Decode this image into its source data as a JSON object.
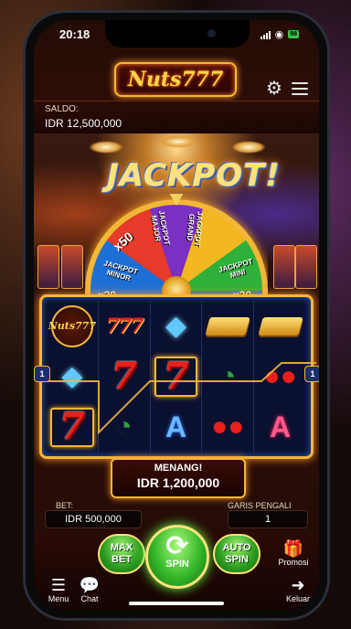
{
  "status": {
    "time": "20:18",
    "battery": "98"
  },
  "header": {
    "logo": "Nuts777"
  },
  "balance": {
    "label": "SALDO:",
    "value": "IDR 12,500,000"
  },
  "banner": {
    "title": "JACKPOT!",
    "wheel_segments": [
      "x50",
      "JACKPOT MAJOR",
      "JACKPOT GRAND",
      "JACKPOT MINOR",
      "JACKPOT MINI",
      "x20",
      "x20"
    ]
  },
  "reels": {
    "payline_numbers": {
      "left": "1",
      "right": "1"
    },
    "rows": [
      [
        "Nuts777",
        "777",
        "diamond",
        "gold-bar",
        "gold-bar"
      ],
      [
        "diamond",
        "7",
        "7",
        "watermelon",
        "cherry"
      ],
      [
        "7",
        "watermelon",
        "A",
        "cherry",
        "A"
      ]
    ],
    "winning_cells": [
      [
        2,
        0
      ],
      [
        1,
        1
      ],
      [
        1,
        2
      ]
    ]
  },
  "win": {
    "label": "MENANG!",
    "amount": "IDR 1,200,000"
  },
  "bet": {
    "label": "BET:",
    "value": "IDR 500,000"
  },
  "lines": {
    "label": "GARIS PENGALI",
    "value": "1"
  },
  "controls": {
    "max_bet": "MAX BET",
    "spin": "SPIN",
    "auto_spin": "AUTO SPIN",
    "promo": "Promosi"
  },
  "nav": {
    "menu": "Menu",
    "chat": "Chat",
    "logout": "Keluar"
  },
  "colors": {
    "gold": "#f4b63a",
    "green": "#36b82a",
    "red": "#e8201a"
  }
}
